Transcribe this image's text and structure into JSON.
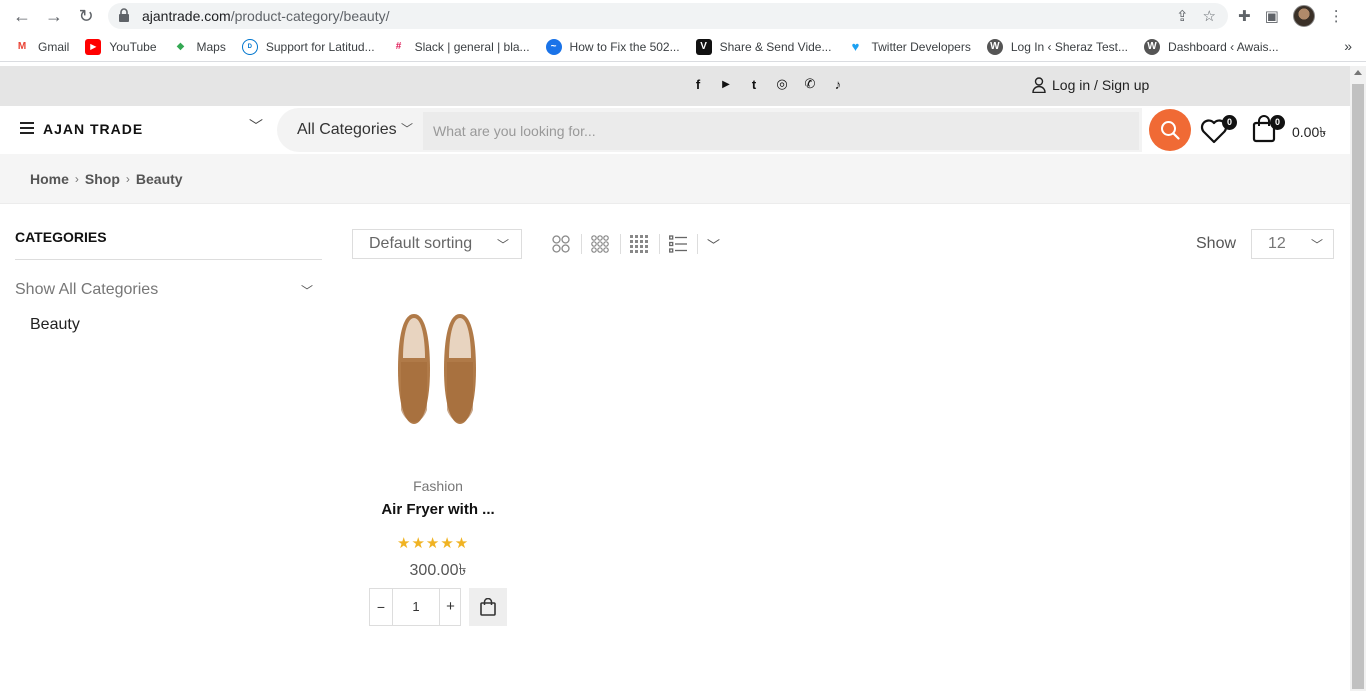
{
  "browser": {
    "url_domain": "ajantrade.com",
    "url_path": "/product-category/beauty/",
    "bookmarks": [
      {
        "label": "Gmail",
        "icon": "gmail-icon"
      },
      {
        "label": "YouTube",
        "icon": "youtube-icon"
      },
      {
        "label": "Maps",
        "icon": "maps-icon"
      },
      {
        "label": "Support for Latitud...",
        "icon": "dell-icon"
      },
      {
        "label": "Slack | general | bla...",
        "icon": "slack-icon"
      },
      {
        "label": "How to Fix the 502...",
        "icon": "globe-icon"
      },
      {
        "label": "Share & Send Vide...",
        "icon": "v-icon"
      },
      {
        "label": "Twitter Developers",
        "icon": "twitter-icon"
      },
      {
        "label": "Log In ‹ Sheraz Test...",
        "icon": "wordpress-icon"
      },
      {
        "label": "Dashboard ‹ Awais...",
        "icon": "wordpress-icon"
      }
    ],
    "more_label": "»"
  },
  "topbar": {
    "social": [
      "f",
      "▶",
      "t",
      "◎",
      "✆",
      "♪"
    ],
    "login_label": "Log in / Sign up"
  },
  "header": {
    "brand": "AJAN TRADE",
    "category_select": "All Categories",
    "search_placeholder": "What are you looking for...",
    "wishlist_count": "0",
    "cart_count": "0",
    "cart_total": "0.00৳"
  },
  "breadcrumb": {
    "items": [
      "Home",
      "Shop",
      "Beauty"
    ]
  },
  "sidebar": {
    "title": "CATEGORIES",
    "show_all": "Show All Categories",
    "items": [
      "Beauty"
    ]
  },
  "toolbar": {
    "sorting": "Default sorting",
    "show_label": "Show",
    "show_value": "12"
  },
  "products": [
    {
      "category": "Fashion",
      "name": "Air Fryer with ...",
      "rating": 5,
      "stars": "★★★★★",
      "price": "300.00৳",
      "quantity": "1"
    }
  ],
  "colors": {
    "accent": "#f06a35",
    "star": "#f0b323",
    "topbar_bg": "#e5e5e5"
  }
}
